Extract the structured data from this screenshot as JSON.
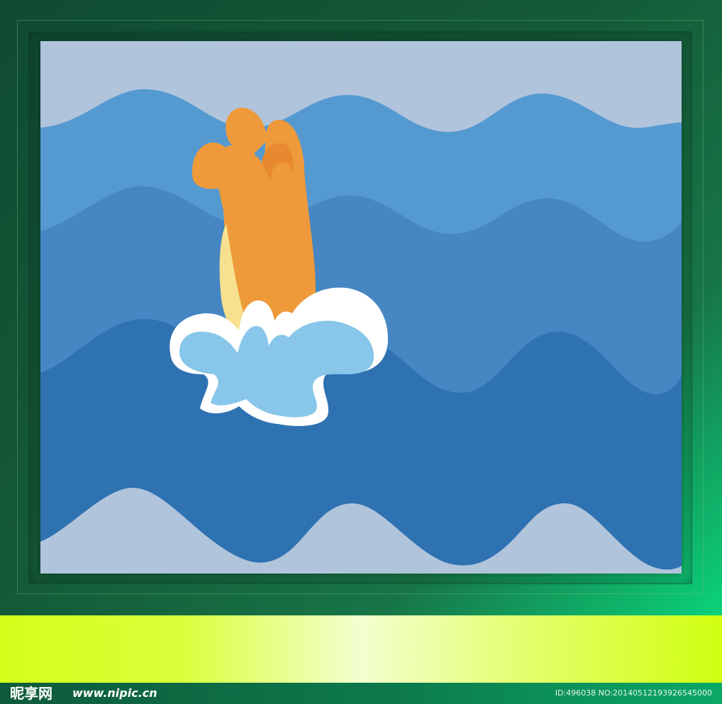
{
  "colors": {
    "frame_dark": "#114a35",
    "frame_light": "#0bd27c",
    "sky": "#b0c4dc",
    "wave_light": "#5599d1",
    "wave_mid": "#4586c3",
    "wave_deep": "#2f72b2",
    "figure_orange": "#ee9a3a",
    "figure_dark_orange": "#e8882f",
    "figure_cream": "#f7e08f",
    "splash_white": "#ffffff",
    "splash_blue": "#88c6ea",
    "band_yellow": "#d4ff1a"
  },
  "watermark": {
    "brand": "昵享网",
    "site": "www.nipic.cn",
    "image_id": "ID:496038 NO:20140512193926545000"
  }
}
